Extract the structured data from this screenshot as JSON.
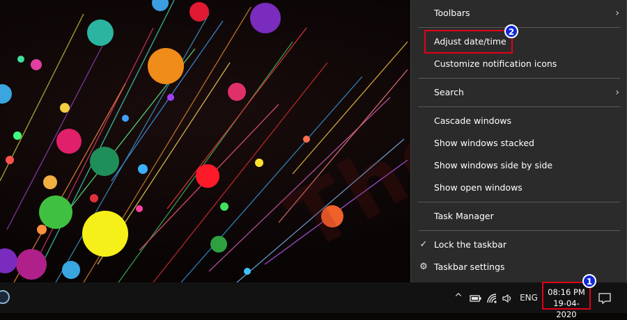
{
  "menu": {
    "toolbars": "Toolbars",
    "adjust_datetime": "Adjust date/time",
    "customize_notifications": "Customize notification icons",
    "search": "Search",
    "cascade": "Cascade windows",
    "stacked": "Show windows stacked",
    "side_by_side": "Show windows side by side",
    "open_windows": "Show open windows",
    "task_manager": "Task Manager",
    "lock_taskbar": "Lock the taskbar",
    "taskbar_settings": "Taskbar settings",
    "chevron": "›",
    "checkmark": "✓",
    "gear": "⚙"
  },
  "badges": {
    "one": "1",
    "two": "2"
  },
  "tray": {
    "chevron_up": "^",
    "language": "ENG",
    "time": "08:16 PM",
    "date": "19-04-2020"
  },
  "watermark": "TheTricks",
  "colors": {
    "menu_bg": "#2b2b2b",
    "taskbar_bg": "#121212",
    "highlight": "#e3001b",
    "badge": "#1028d8"
  }
}
